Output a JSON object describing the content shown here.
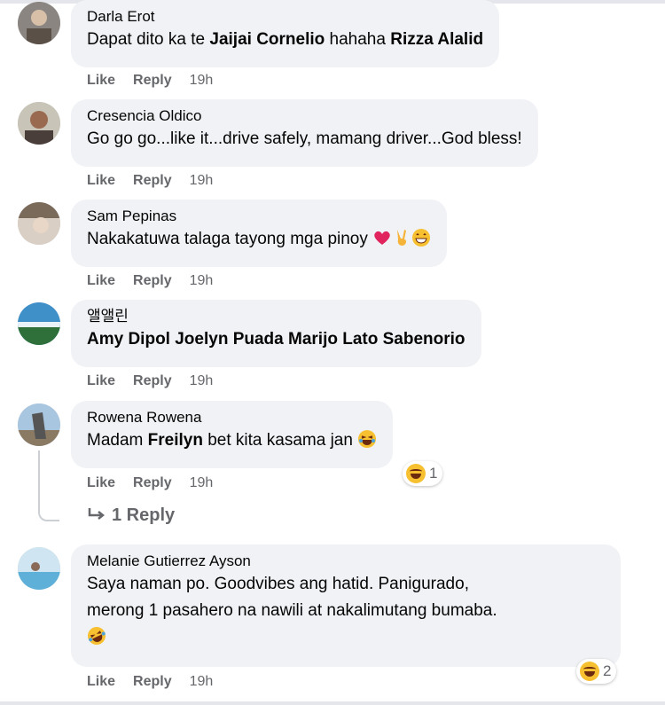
{
  "actions": {
    "like": "Like",
    "reply": "Reply"
  },
  "comments": [
    {
      "author": "Darla Erot",
      "text_parts": [
        "Dapat dito ka te ",
        "Jaijai Cornelio",
        " hahaha ",
        "Rizza Alalid"
      ],
      "time": "19h"
    },
    {
      "author": "Cresencia Oldico",
      "text": "Go go go...like it...drive safely, mamang driver...God bless!",
      "time": "19h"
    },
    {
      "author": "Sam Pepinas",
      "text": "Nakakatuwa talaga tayong mga pinoy",
      "emojis": [
        "red-heart",
        "victory-hand",
        "grinning-face"
      ],
      "time": "19h"
    },
    {
      "author": "앨앨린",
      "text": "Amy Dipol Joelyn Puada Marijo Lato Sabenorio",
      "time": "19h"
    },
    {
      "author": "Rowena Rowena",
      "text_parts": [
        "Madam ",
        "Freilyn",
        " bet kita kasama jan"
      ],
      "emoji": "laughing-face",
      "reaction_count": "1",
      "time": "19h",
      "replies_label": "1 Reply"
    },
    {
      "author": "Melanie Gutierrez Ayson",
      "text_line1": "Saya naman po. Goodvibes ang hatid. Panigurado,",
      "text_line2": "merong 1 pasahero na nawili at nakalimutang bumaba.",
      "emoji": "rolling-laughing-face",
      "reaction_count": "2",
      "time": "19h"
    }
  ]
}
